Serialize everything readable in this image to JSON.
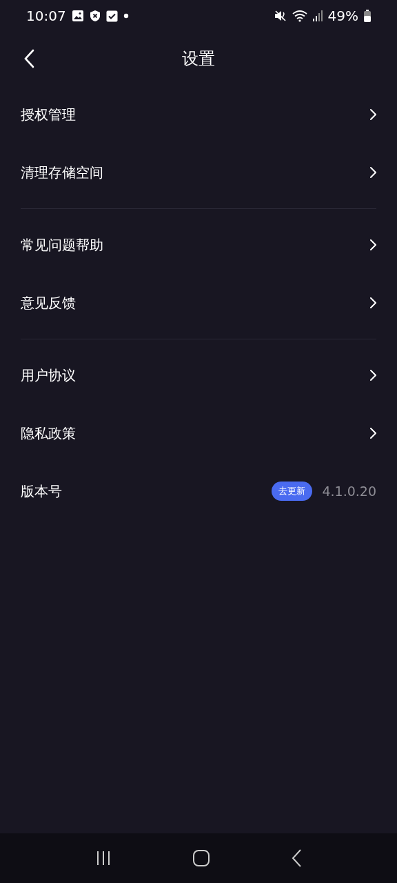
{
  "status_bar": {
    "time": "10:07",
    "battery": "49%"
  },
  "header": {
    "title": "设置"
  },
  "groups": [
    {
      "items": [
        {
          "kind": "link",
          "label": "授权管理"
        },
        {
          "kind": "link",
          "label": "清理存储空间"
        }
      ]
    },
    {
      "items": [
        {
          "kind": "link",
          "label": "常见问题帮助"
        },
        {
          "kind": "link",
          "label": "意见反馈"
        }
      ]
    },
    {
      "items": [
        {
          "kind": "link",
          "label": "用户协议"
        },
        {
          "kind": "link",
          "label": "隐私政策"
        },
        {
          "kind": "version",
          "label": "版本号",
          "badge": "去更新",
          "value": "4.1.0.20"
        }
      ]
    }
  ]
}
